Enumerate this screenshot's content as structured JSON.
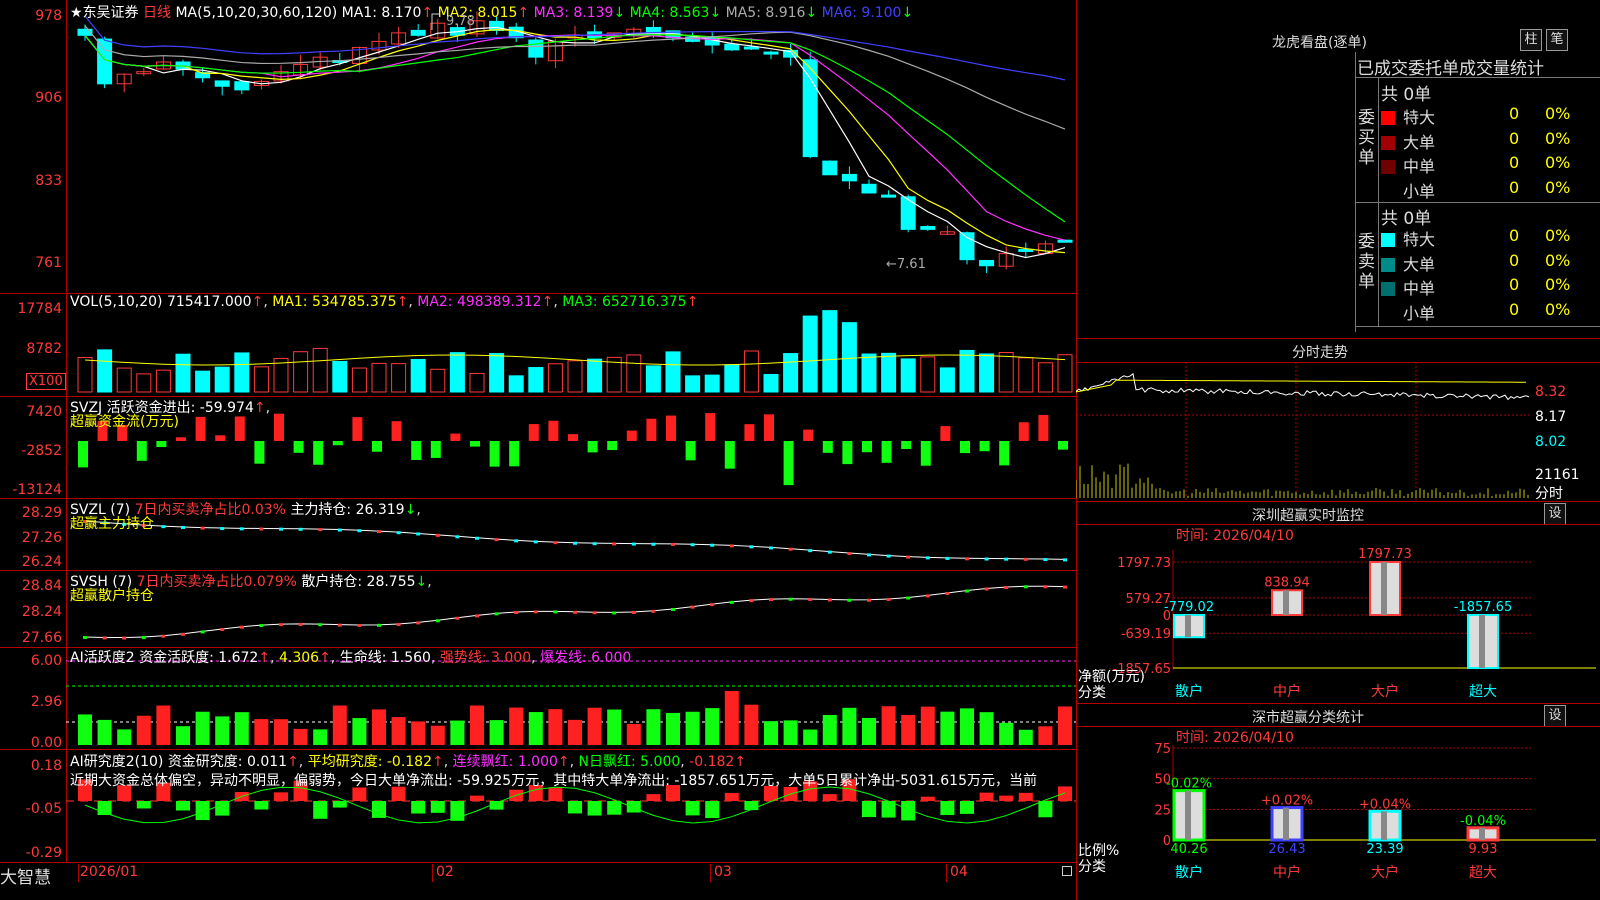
{
  "header": {
    "star": "★",
    "stock_name": "东吴证券",
    "period": "日线",
    "ma_label": "MA(5,10,20,30,60,120)",
    "ma1": "MA1: 8.170",
    "ma2": "MA2: 8.015",
    "ma3": "MA3: 8.139",
    "ma4": "MA4: 8.563",
    "ma5": "MA5: 8.916",
    "ma6": "MA6: 9.100",
    "high_note": "9.78",
    "low_note": "←7.61"
  },
  "price_axis": [
    "978",
    "906",
    "833",
    "761"
  ],
  "vol": {
    "label": "VOL(5,10,20)",
    "value": "715417.000",
    "ma1": "MA1: 534785.375",
    "ma2": "MA2: 498389.312",
    "ma3": "MA3: 652716.375",
    "axis": [
      "17784",
      "8782"
    ],
    "unit": "X100"
  },
  "svzj": {
    "label": "SVZJ",
    "title": "活跃资金进出: -59.974",
    "subtitle": "超赢资金流(万元)",
    "axis": [
      "7420",
      "-2852",
      "-13124"
    ]
  },
  "svzl": {
    "label": "SVZL (7)",
    "ratio": "7日内买卖净占比0.03%",
    "hold": "主力持仓: 26.319",
    "subtitle": "超赢主力持仓",
    "axis": [
      "28.29",
      "27.26",
      "26.24"
    ]
  },
  "svsh": {
    "label": "SVSH (7)",
    "ratio": "7日内买卖净占比0.079%",
    "hold": "散户持仓: 28.755",
    "subtitle": "超赢散户持仓",
    "axis": [
      "28.84",
      "28.24",
      "27.66"
    ]
  },
  "ai_active": {
    "label": "AI活跃度2",
    "active": "资金活跃度: 1.672",
    "v2": "4.306",
    "life": "生命线: 1.560",
    "strong": "强势线: 3.000",
    "burst": "爆发线: 6.000",
    "axis": [
      "6.00",
      "2.96",
      "0.00"
    ]
  },
  "ai_research": {
    "label": "AI研究度2(10)",
    "research": "资金研究度: 0.011",
    "avg": "平均研究度: -0.182",
    "streak": "连续飘红: 1.000",
    "nday": "N日飘红: 5.000",
    "extra": "-0.182",
    "summary": "近期大资金总体偏空，异动不明显，偏弱势，今日大单净流出: -59.925万元，其中特大单净流出: -1857.651万元，大单5日累计净出-5031.615万元，当前",
    "axis": [
      "0.18",
      "-0.05",
      "-0.29"
    ]
  },
  "bottom_axis": {
    "app": "大智慧",
    "dates": [
      "2026/01",
      "02",
      "03",
      "04"
    ]
  },
  "right_panel": {
    "dragon_tiger": "龙虎看盘(逐单)",
    "btn_bar": "柱",
    "btn_pen": "笔",
    "stats_title": "已成交委托单成交量统计",
    "buy_label": "委买单",
    "sell_label": "委卖单",
    "buy_total": "共 0单",
    "sell_total": "共 0单",
    "buy_rows": [
      {
        "name": "特大",
        "count": "0",
        "pct": "0%",
        "color": "#ff0000"
      },
      {
        "name": "大单",
        "count": "0",
        "pct": "0%",
        "color": "#a00000"
      },
      {
        "name": "中单",
        "count": "0",
        "pct": "0%",
        "color": "#700000"
      },
      {
        "name": "小单",
        "count": "0",
        "pct": "0%",
        "color": "#000000"
      }
    ],
    "sell_rows": [
      {
        "name": "特大",
        "count": "0",
        "pct": "0%",
        "color": "#00ffff"
      },
      {
        "name": "大单",
        "count": "0",
        "pct": "0%",
        "color": "#008b8b"
      },
      {
        "name": "中单",
        "count": "0",
        "pct": "0%",
        "color": "#006f6f"
      },
      {
        "name": "小单",
        "count": "0",
        "pct": "0%",
        "color": "#000000"
      }
    ],
    "intraday_title": "分时走势",
    "intraday_axis": [
      "8.32",
      "8.17",
      "8.02"
    ],
    "intraday_vol": "21161",
    "intraday_unit": "分时",
    "sz_title": "深圳超赢实时监控",
    "sz_btn": "设",
    "sz_time": "时间: 2026/04/10",
    "sz_axis": [
      "1797.73",
      "579.27",
      "0",
      "-639.19",
      "-1857.65"
    ],
    "sz_ylabel": "净额(万元)",
    "sz_xlabel": "分类",
    "sz_bars": [
      {
        "cat": "散户",
        "value": "-779.02"
      },
      {
        "cat": "中户",
        "value": "838.94"
      },
      {
        "cat": "大户",
        "value": "1797.73"
      },
      {
        "cat": "超大",
        "value": "-1857.65"
      }
    ],
    "cls_title": "深市超赢分类统计",
    "cls_btn": "设",
    "cls_time": "时间: 2026/04/10",
    "cls_axis": [
      "75",
      "50",
      "25",
      "0"
    ],
    "cls_ylabel": "比例%",
    "cls_xlabel": "分类",
    "cls_bars": [
      {
        "cat": "散户",
        "pct": "40.26",
        "chg": "-0.02%"
      },
      {
        "cat": "中户",
        "pct": "26.43",
        "chg": "+0.02%"
      },
      {
        "cat": "大户",
        "pct": "23.39",
        "chg": "+0.04%"
      },
      {
        "cat": "超大",
        "pct": "9.93",
        "chg": "-0.04%"
      }
    ]
  }
}
